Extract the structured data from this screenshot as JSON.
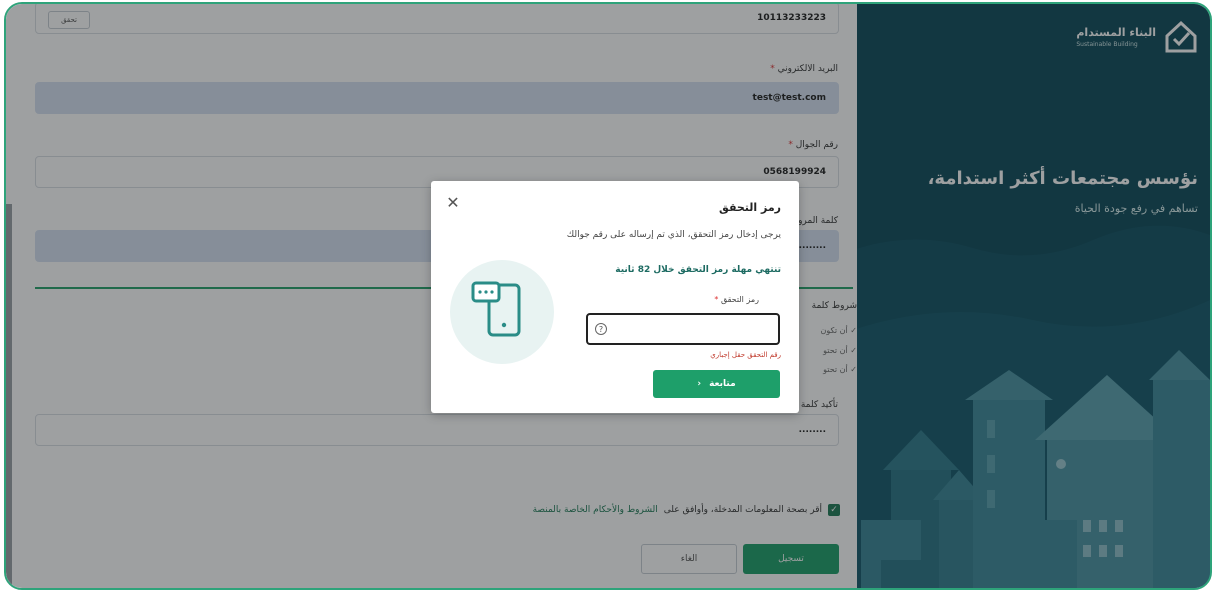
{
  "hero": {
    "brand_ar": "البناء المستدام",
    "brand_en": "Sustainable Building",
    "title": "نؤسس مجتمعات أكثر استدامة،",
    "subtitle": "تساهم في رفع جودة الحياة",
    "bg_color": "#0f4a5a"
  },
  "form": {
    "id_value": "10113233223",
    "verify_button": "تحقق",
    "email_label": "البريد الالكتروني",
    "email_value": "test@test.com",
    "phone_label": "رقم الجوال",
    "phone_value": "0568199924",
    "password_label": "كلمة المرور",
    "password_value": "........",
    "conditions_title": "شروط كلمة",
    "conditions": [
      "أن تكون",
      "أن تحتو",
      "أن تحتو"
    ],
    "confirm_label": "تأكيد كلمة ا",
    "confirm_value": "........",
    "agree_text": "أقر بصحة المعلومات المدخلة، وأوافق على",
    "agree_link": "الشروط والأحكام الخاصة بالمنصة",
    "register_button": "تسجيل",
    "cancel_button": "الغاء",
    "accent_color": "#1e9f6a"
  },
  "modal": {
    "title": "رمز التحقق",
    "description": "يرجى إدخال رمز التحقق، الذي تم إرساله على رقم جوالك",
    "timer_text": "تنتهي مهلة رمز التحقق خلال 82 ثانية",
    "otp_label": "رمز التحقق",
    "otp_value": "",
    "otp_placeholder": "",
    "error_text": "رقم التحقق حقل إجباري",
    "continue_button": "متابعة",
    "close_icon": "close-icon",
    "illustration_icon": "mobile-chat-icon"
  }
}
